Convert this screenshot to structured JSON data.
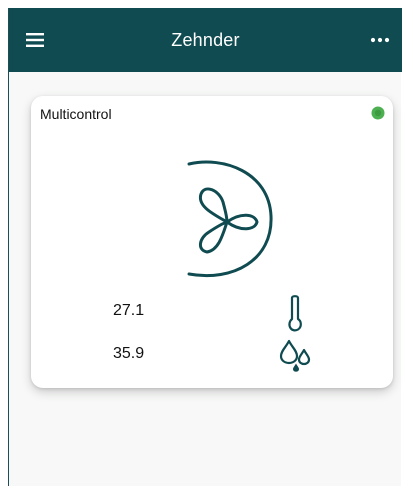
{
  "appbar": {
    "title": "Zehnder",
    "menu_icon": "hamburger-menu-icon",
    "more_icon": "more-options-icon"
  },
  "device_card": {
    "name": "Multicontrol",
    "status": "online",
    "status_color": "#4caf50",
    "main_icon": "ventilation-fan-icon",
    "temperature": "27.1",
    "temperature_icon": "thermometer-icon",
    "humidity": "35.9",
    "humidity_icon": "humidity-drops-icon"
  },
  "colors": {
    "brand": "#0f4b50",
    "icon": "#0f4b50",
    "background": "#f7f8f7",
    "card": "#ffffff"
  }
}
